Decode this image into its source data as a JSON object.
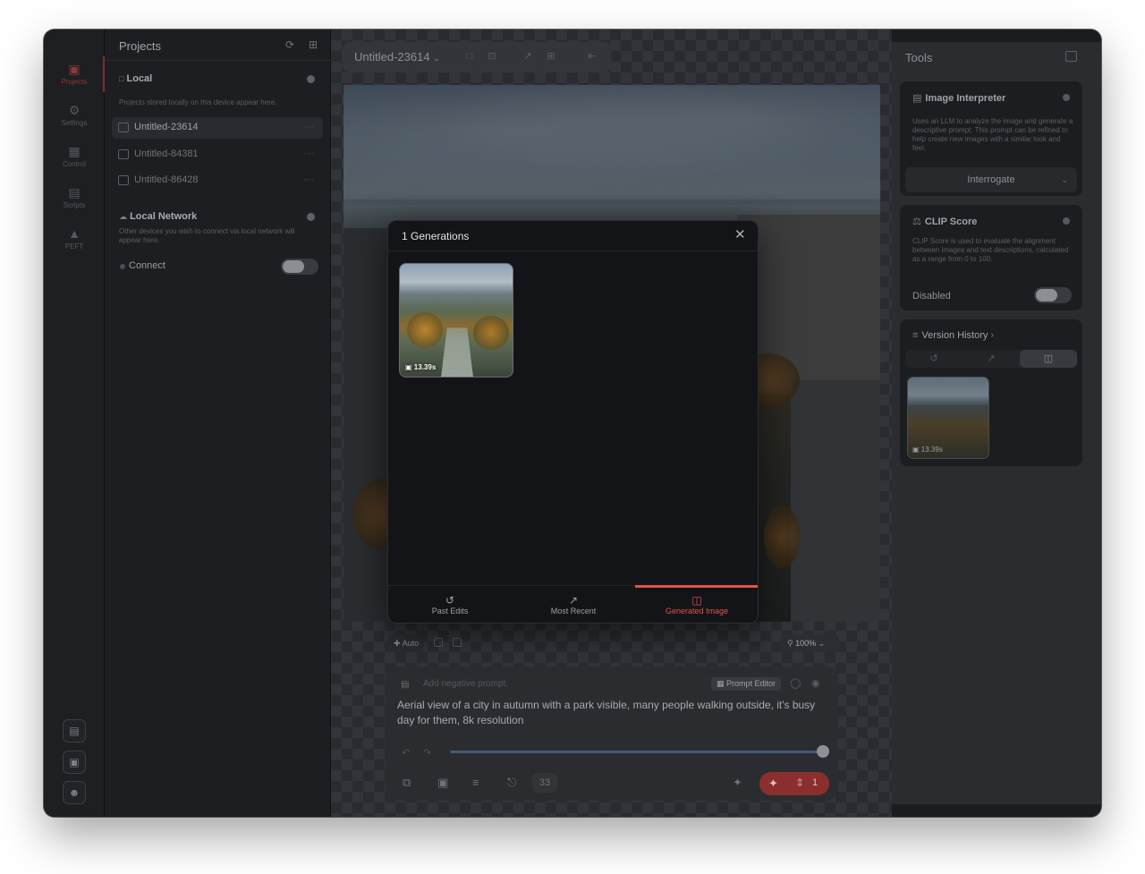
{
  "window": {
    "rail": {
      "items": [
        {
          "label": "Projects",
          "icon": "projects-icon"
        },
        {
          "label": "Settings",
          "icon": "settings-icon"
        },
        {
          "label": "Control",
          "icon": "control-icon"
        },
        {
          "label": "Scripts",
          "icon": "scripts-icon"
        },
        {
          "label": "PEFT",
          "icon": "peft-icon"
        }
      ],
      "active": "Projects",
      "accent": "#8b3a36"
    },
    "projects": {
      "title": "Projects",
      "local": {
        "title": "Local",
        "description": "Projects stored locally on this device appear here.",
        "items": [
          "Untitled-23614",
          "Untitled-84381",
          "Untitled-86428"
        ],
        "selected": "Untitled-23614"
      },
      "network": {
        "title": "Local Network",
        "description": "Other devices you wish to connect via local network will appear here.",
        "connect_label": "Connect",
        "connect_on": false
      }
    },
    "canvas": {
      "project_name": "Untitled-23614",
      "auto_label": "Auto",
      "zoom": "100%"
    },
    "prompt": {
      "negative_placeholder": "Add negative prompt.",
      "prompt_editor_label": "Prompt Editor",
      "text": "Aerial view of a city in autumn with a park visible, many people walking outside, it's busy day for them, 8k resolution",
      "steps": "33",
      "generate_count": "1",
      "accent": "#8a2f2d"
    },
    "tools": {
      "title": "Tools",
      "image_interpreter": {
        "title": "Image Interpreter",
        "description": "Uses an LLM to analyze the image and generate a descriptive prompt. This prompt can be refined to help create new images with a similar look and feel.",
        "button": "Interrogate"
      },
      "clip_score": {
        "title": "CLIP Score",
        "description": "CLIP Score is used to evaluate the alignment between images and text descriptions, calculated as a range from 0 to 100.",
        "state_label": "Disabled",
        "enabled": false
      },
      "version_history": {
        "title": "Version History",
        "thumb_caption": "13.39s"
      }
    },
    "modal": {
      "title": "1 Generations",
      "thumb_caption": "13.39s",
      "tabs": [
        "Past Edits",
        "Most Recent",
        "Generated Image"
      ],
      "active_tab": "Generated Image",
      "accent": "#e0554e"
    }
  }
}
